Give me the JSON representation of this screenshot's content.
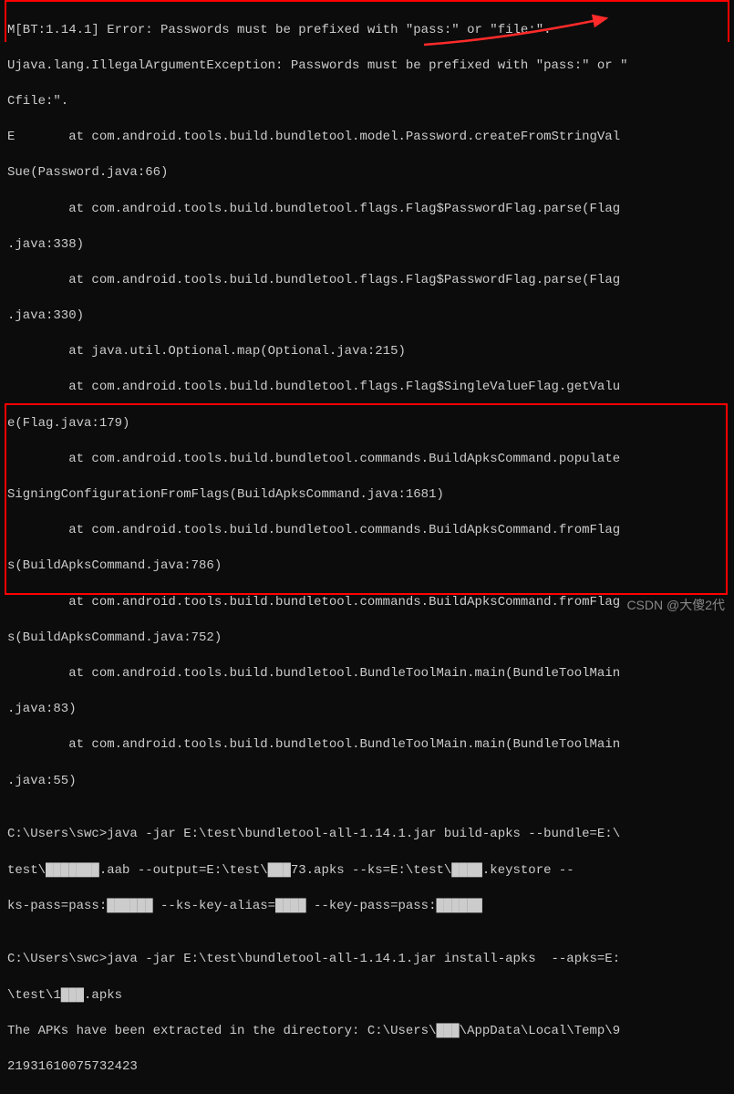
{
  "terminal": {
    "lines": [
      "M[BT:1.14.1] Error: Passwords must be prefixed with \"pass:\" or \"file:\".",
      "Ujava.lang.IllegalArgumentException: Passwords must be prefixed with \"pass:\" or \"",
      "Cfile:\".",
      "E       at com.android.tools.build.bundletool.model.Password.createFromStringVal",
      "Sue(Password.java:66)",
      "        at com.android.tools.build.bundletool.flags.Flag$PasswordFlag.parse(Flag",
      ".java:338)",
      "        at com.android.tools.build.bundletool.flags.Flag$PasswordFlag.parse(Flag",
      ".java:330)",
      "        at java.util.Optional.map(Optional.java:215)",
      "        at com.android.tools.build.bundletool.flags.Flag$SingleValueFlag.getValu",
      "e(Flag.java:179)",
      "        at com.android.tools.build.bundletool.commands.BuildApksCommand.populate",
      "SigningConfigurationFromFlags(BuildApksCommand.java:1681)",
      "        at com.android.tools.build.bundletool.commands.BuildApksCommand.fromFlag",
      "s(BuildApksCommand.java:786)",
      "        at com.android.tools.build.bundletool.commands.BuildApksCommand.fromFlag",
      "s(BuildApksCommand.java:752)",
      "        at com.android.tools.build.bundletool.BundleToolMain.main(BundleToolMain",
      ".java:83)",
      "        at com.android.tools.build.bundletool.BundleToolMain.main(BundleToolMain",
      ".java:55)",
      "",
      "C:\\Users\\swc>java -jar E:\\test\\bundletool-all-1.14.1.jar build-apks --bundle=E:\\",
      "test\\███████.aab --output=E:\\test\\███73.apks --ks=E:\\test\\████.keystore --",
      "ks-pass=pass:██████ --ks-key-alias=████ --key-pass=pass:██████",
      "",
      "C:\\Users\\swc>java -jar E:\\test\\bundletool-all-1.14.1.jar install-apks  --apks=E:",
      "\\test\\1███.apks",
      "The APKs have been extracted in the directory: C:\\Users\\███\\AppData\\Local\\Temp\\9",
      "21931610075732423"
    ]
  },
  "watermark": "CSDN @大傻2代"
}
